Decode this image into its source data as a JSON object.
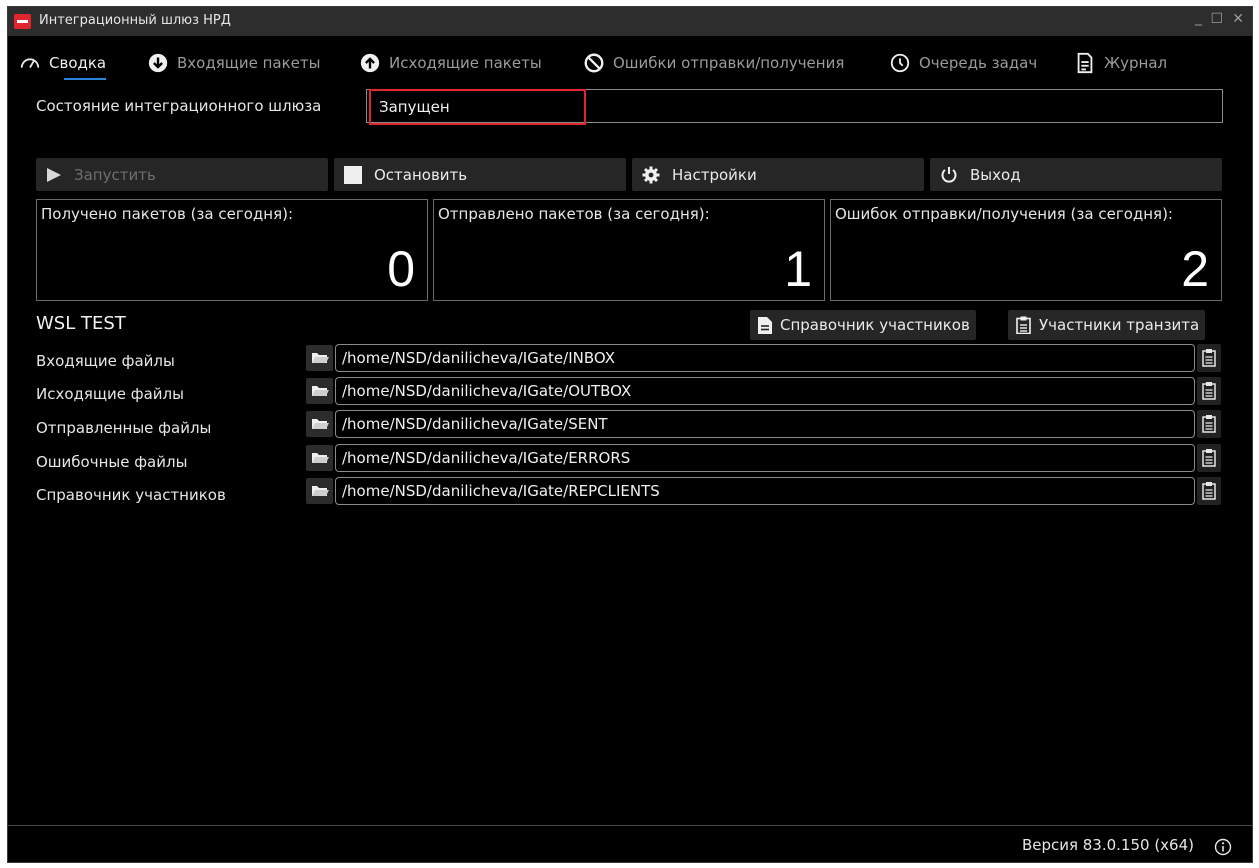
{
  "window": {
    "title": "Интеграционный шлюз НРД",
    "minimize": "_",
    "maximize": "☐",
    "close": "✕"
  },
  "tabs": [
    {
      "label": "Сводка",
      "icon": "gauge-icon",
      "active": true
    },
    {
      "label": "Входящие пакеты",
      "icon": "arrow-down-circle-icon",
      "active": false
    },
    {
      "label": "Исходящие пакеты",
      "icon": "arrow-up-circle-icon",
      "active": false
    },
    {
      "label": "Ошибки отправки/получения",
      "icon": "ban-icon",
      "active": false
    },
    {
      "label": "Очередь задач",
      "icon": "clock-icon",
      "active": false
    },
    {
      "label": "Журнал",
      "icon": "document-icon",
      "active": false
    }
  ],
  "gateway_state": {
    "label": "Состояние интеграционного шлюза",
    "value": "Запущен"
  },
  "buttons": {
    "start": "Запустить",
    "stop": "Остановить",
    "settings": "Настройки",
    "exit": "Выход"
  },
  "counters": [
    {
      "label": "Получено пакетов (за сегодня):",
      "value": "0"
    },
    {
      "label": "Отправлено пакетов (за сегодня):",
      "value": "1"
    },
    {
      "label": "Ошибок отправки/получения (за сегодня):",
      "value": "2"
    }
  ],
  "section": {
    "title": "WSL TEST",
    "directory_button": "Справочник участников",
    "transit_button": "Участники транзита"
  },
  "paths": [
    {
      "label": "Входящие файлы",
      "value": "/home/NSD/danilicheva/IGate/INBOX"
    },
    {
      "label": "Исходящие файлы",
      "value": "/home/NSD/danilicheva/IGate/OUTBOX"
    },
    {
      "label": "Отправленные файлы",
      "value": "/home/NSD/danilicheva/IGate/SENT"
    },
    {
      "label": "Ошибочные файлы",
      "value": "/home/NSD/danilicheva/IGate/ERRORS"
    },
    {
      "label": "Справочник участников",
      "value": "/home/NSD/danilicheva/IGate/REPCLIENTS"
    }
  ],
  "footer": {
    "version": "Версия 83.0.150 (x64)"
  },
  "colors": {
    "accent": "#2a86d8",
    "highlight": "#e0262d",
    "background": "#000000"
  }
}
